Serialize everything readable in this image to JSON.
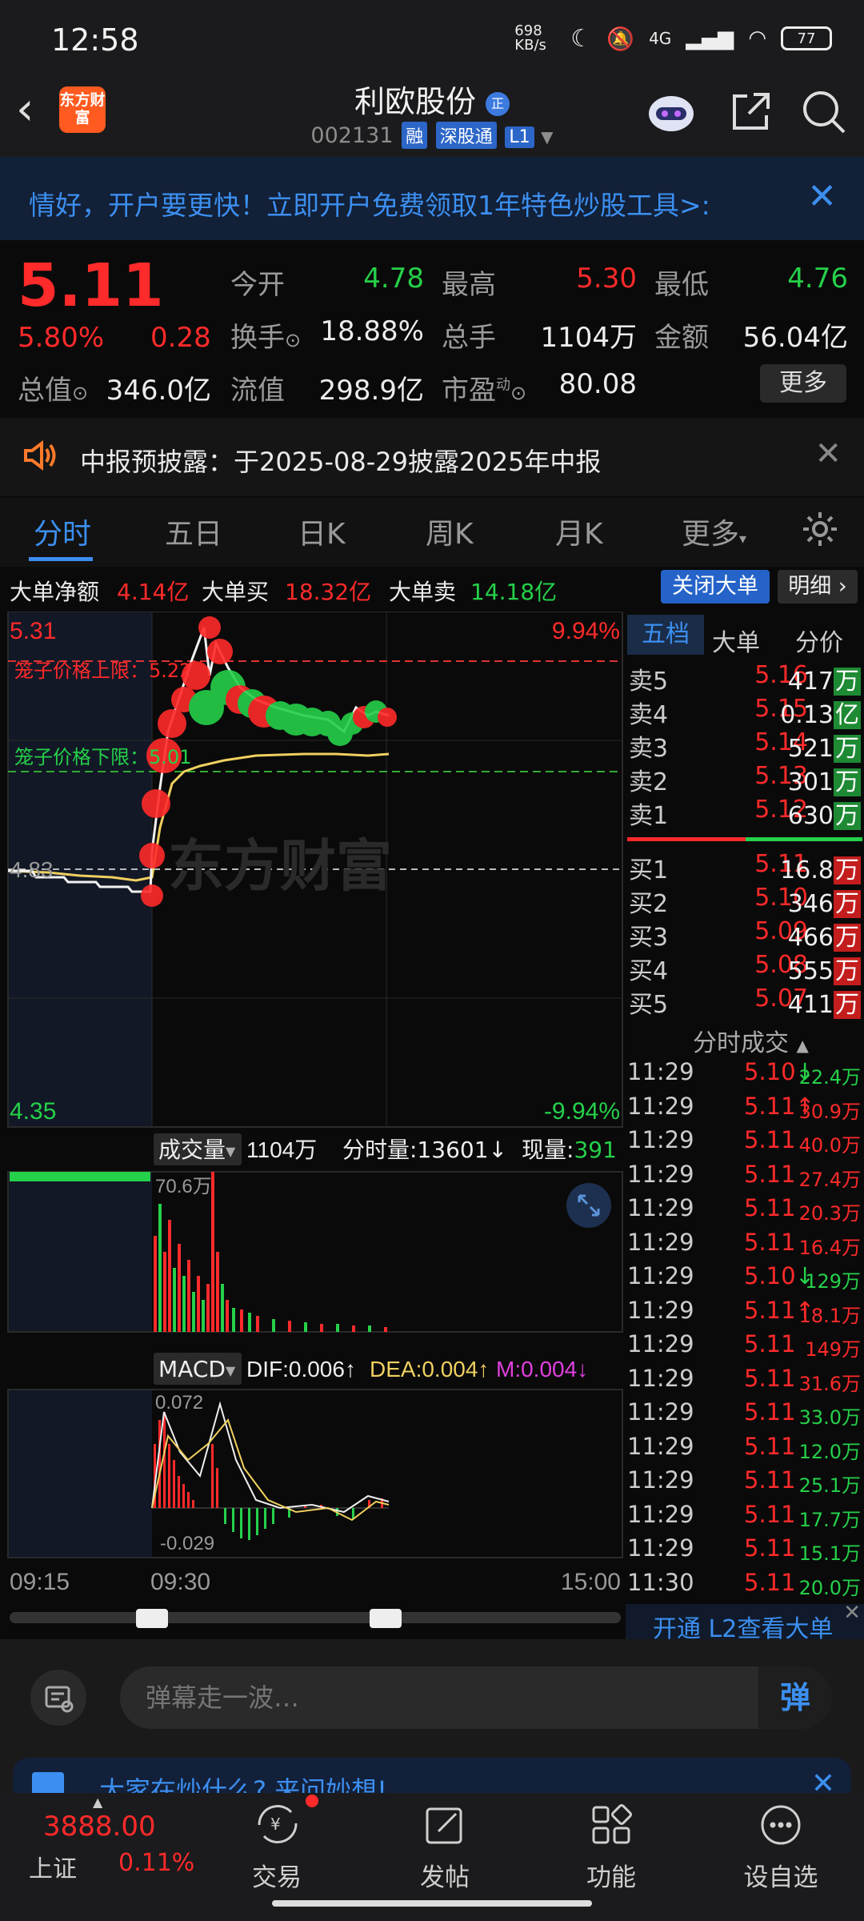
{
  "status": {
    "time": "12:58",
    "speed": "698 KB/s",
    "net": "4G",
    "battery": "77"
  },
  "header": {
    "name": "利欧股份",
    "badge": "正",
    "code": "002131",
    "tags": [
      "融",
      "深股通",
      "L1"
    ],
    "logo": "东方财富"
  },
  "banner": {
    "text": "情好，开户要更快！立即开户免费领取1年特色炒股工具>:"
  },
  "quote": {
    "price": "5.11",
    "pct": "5.80%",
    "chg": "0.28",
    "open_l": "今开",
    "open": "4.78",
    "high_l": "最高",
    "high": "5.30",
    "low_l": "最低",
    "low": "4.76",
    "turn_l": "换手",
    "turn": "18.88%",
    "vol_l": "总手",
    "vol": "1104万",
    "amt_l": "金额",
    "amt": "56.04亿",
    "mcap_l": "总值",
    "mcap": "346.0亿",
    "fcap_l": "流值",
    "fcap": "298.9亿",
    "pe_l": "市盈",
    "pe_sup": "动",
    "pe": "80.08",
    "more": "更多"
  },
  "notice": {
    "text": "中报预披露：于2025-08-29披露2025年中报"
  },
  "tabs": [
    "分时",
    "五日",
    "日K",
    "周K",
    "月K",
    "更多"
  ],
  "bigorder": {
    "net_l": "大单净额",
    "net": "4.14亿",
    "buy_l": "大单买",
    "buy": "18.32亿",
    "sell_l": "大单卖",
    "sell": "14.18亿",
    "close_btn": "关闭大单",
    "detail_btn": "明细"
  },
  "chart": {
    "top": "5.31",
    "top_pct": "9.94%",
    "upper": "笼子价格上限：5.22",
    "lower": "笼子价格下限：5.01",
    "pre": "4.83",
    "bottom": "4.35",
    "bottom_pct": "-9.94%",
    "watermark": "东方财富",
    "vol_l": "成交量",
    "vol": "1104万",
    "fsl": "分时量:13601",
    "xl": "现量:",
    "xl_v": "391",
    "vol_max": "70.6万",
    "macd_l": "MACD",
    "dif": "DIF:0.006",
    "dea": "DEA:0.004",
    "m": "M:0.004",
    "macd_top": "0.072",
    "macd_bot": "-0.029",
    "t1": "09:15",
    "t2": "09:30",
    "t3": "15:00"
  },
  "orderbook": {
    "tabs": [
      "五档",
      "大单",
      "分价"
    ],
    "asks": [
      {
        "l": "卖5",
        "p": "5.16",
        "v": "417",
        "u": "万"
      },
      {
        "l": "卖4",
        "p": "5.15",
        "v": "0.13",
        "u": "亿"
      },
      {
        "l": "卖3",
        "p": "5.14",
        "v": "521",
        "u": "万"
      },
      {
        "l": "卖2",
        "p": "5.13",
        "v": "301",
        "u": "万"
      },
      {
        "l": "卖1",
        "p": "5.12",
        "v": "630",
        "u": "万"
      }
    ],
    "bids": [
      {
        "l": "买1",
        "p": "5.11",
        "v": "16.8",
        "u": "万"
      },
      {
        "l": "买2",
        "p": "5.10",
        "v": "346",
        "u": "万"
      },
      {
        "l": "买3",
        "p": "5.09",
        "v": "466",
        "u": "万"
      },
      {
        "l": "买4",
        "p": "5.08",
        "v": "555",
        "u": "万"
      },
      {
        "l": "买5",
        "p": "5.07",
        "v": "411",
        "u": "万"
      }
    ],
    "trades_title": "分时成交",
    "trades": [
      {
        "t": "11:29",
        "p": "5.10",
        "a": "↓",
        "v": "22.4万",
        "c": "g"
      },
      {
        "t": "11:29",
        "p": "5.11",
        "a": "↑",
        "v": "30.9万",
        "c": "r"
      },
      {
        "t": "11:29",
        "p": "5.11",
        "a": "",
        "v": "40.0万",
        "c": "r"
      },
      {
        "t": "11:29",
        "p": "5.11",
        "a": "",
        "v": "27.4万",
        "c": "r"
      },
      {
        "t": "11:29",
        "p": "5.11",
        "a": "",
        "v": "20.3万",
        "c": "r"
      },
      {
        "t": "11:29",
        "p": "5.11",
        "a": "",
        "v": "16.4万",
        "c": "r"
      },
      {
        "t": "11:29",
        "p": "5.10",
        "a": "↓",
        "v": "129万",
        "c": "g"
      },
      {
        "t": "11:29",
        "p": "5.11",
        "a": "↑",
        "v": "18.1万",
        "c": "r"
      },
      {
        "t": "11:29",
        "p": "5.11",
        "a": "",
        "v": "149万",
        "c": "r"
      },
      {
        "t": "11:29",
        "p": "5.11",
        "a": "",
        "v": "31.6万",
        "c": "r"
      },
      {
        "t": "11:29",
        "p": "5.11",
        "a": "",
        "v": "33.0万",
        "c": "g"
      },
      {
        "t": "11:29",
        "p": "5.11",
        "a": "",
        "v": "12.0万",
        "c": "g"
      },
      {
        "t": "11:29",
        "p": "5.11",
        "a": "",
        "v": "25.1万",
        "c": "g"
      },
      {
        "t": "11:29",
        "p": "5.11",
        "a": "",
        "v": "17.7万",
        "c": "g"
      },
      {
        "t": "11:29",
        "p": "5.11",
        "a": "",
        "v": "15.1万",
        "c": "g"
      },
      {
        "t": "11:30",
        "p": "5.11",
        "a": "",
        "v": "20.0万",
        "c": "g"
      }
    ],
    "l2": "开通 L2查看大单"
  },
  "input": {
    "placeholder": "弹幕走一波…",
    "send": "弹",
    "promo": "大家在炒什么? 来问妙想!"
  },
  "tabbar": {
    "index_v": "3888.00",
    "index_n": "上证",
    "index_p": "0.11%",
    "trade": "交易",
    "post": "发帖",
    "func": "功能",
    "watch": "设自选"
  }
}
